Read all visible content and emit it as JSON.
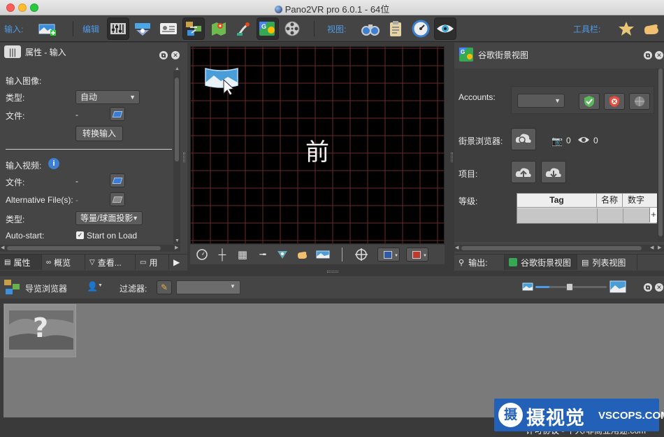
{
  "window": {
    "title": "Pano2VR pro 6.0.1 - 64位"
  },
  "toolbar": {
    "input_label": "输入:",
    "edit_label": "编辑",
    "view_label": "视图:",
    "tools_label": "工具栏:"
  },
  "properties_panel": {
    "title": "属性 - 输入",
    "input_image_section": "输入图像:",
    "type_label": "类型:",
    "type_value": "自动",
    "file_label": "文件:",
    "file_value": "-",
    "convert_button": "转换输入",
    "input_video_section": "输入视频:",
    "video_file_label": "文件:",
    "video_file_value": "-",
    "alt_files_label": "Alternative File(s):",
    "alt_files_value": "-",
    "video_type_label": "类型:",
    "video_type_value": "等量/球面投影",
    "autostart_label": "Auto-start:",
    "start_on_load_label": "Start on Load",
    "start_on_load_checked": true,
    "tabs": [
      "属性",
      "概览",
      "查看...",
      "用"
    ]
  },
  "viewer": {
    "direction_label": "前"
  },
  "streetview_panel": {
    "title": "谷歌街景视图",
    "accounts_label": "Accounts:",
    "accounts_value": "",
    "browser_label": "街景浏览器:",
    "photo_count": "0",
    "view_count": "0",
    "project_label": "项目:",
    "level_label": "等级:",
    "table_headers": [
      "Tag",
      "名称",
      "数字"
    ],
    "tabs": [
      "输出:",
      "谷歌街景视图",
      "列表视图"
    ]
  },
  "tour_browser": {
    "title": "导览浏览器",
    "filter_label": "过滤器:",
    "filter_value": "",
    "zoom_level": 0.2
  },
  "watermark": {
    "brand_cn": "摄视觉",
    "brand_en": "VSCOPS.COM",
    "logo_char": "摄",
    "bottom_text": "许可协议 - 个人/非商业用途.com"
  }
}
